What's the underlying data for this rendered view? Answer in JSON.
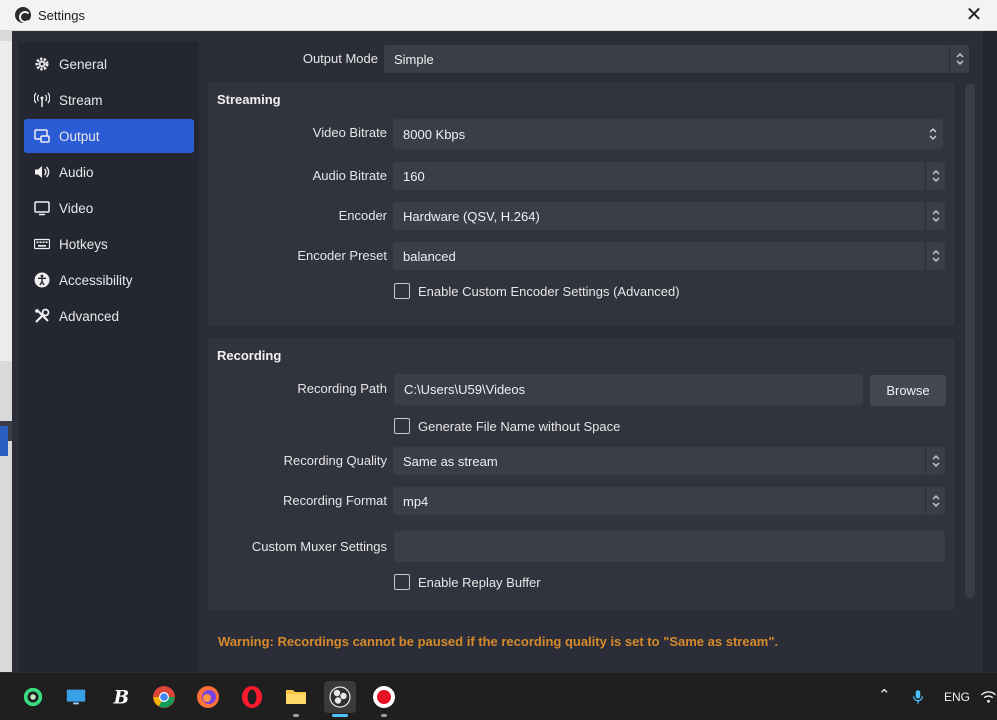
{
  "window": {
    "title": "Settings",
    "close_glyph": "✕"
  },
  "sidebar": {
    "items": [
      {
        "label": "General",
        "icon": "gear-icon"
      },
      {
        "label": "Stream",
        "icon": "antenna-icon"
      },
      {
        "label": "Output",
        "icon": "output-icon",
        "active": true
      },
      {
        "label": "Audio",
        "icon": "speaker-icon"
      },
      {
        "label": "Video",
        "icon": "monitor-icon"
      },
      {
        "label": "Hotkeys",
        "icon": "keyboard-icon"
      },
      {
        "label": "Accessibility",
        "icon": "accessibility-icon"
      },
      {
        "label": "Advanced",
        "icon": "tools-icon"
      }
    ]
  },
  "output_mode": {
    "label": "Output Mode",
    "value": "Simple"
  },
  "streaming": {
    "title": "Streaming",
    "video_bitrate": {
      "label": "Video Bitrate",
      "value": "8000 Kbps"
    },
    "audio_bitrate": {
      "label": "Audio Bitrate",
      "value": "160"
    },
    "encoder": {
      "label": "Encoder",
      "value": "Hardware (QSV, H.264)"
    },
    "encoder_preset": {
      "label": "Encoder Preset",
      "value": "balanced"
    },
    "custom_encoder": {
      "label": "Enable Custom Encoder Settings (Advanced)",
      "checked": false
    }
  },
  "recording": {
    "title": "Recording",
    "path": {
      "label": "Recording Path",
      "value": "C:\\Users\\U59\\Videos"
    },
    "browse_label": "Browse",
    "no_space": {
      "label": "Generate File Name without Space",
      "checked": false
    },
    "quality": {
      "label": "Recording Quality",
      "value": "Same as stream"
    },
    "format": {
      "label": "Recording Format",
      "value": "mp4"
    },
    "muxer": {
      "label": "Custom Muxer Settings",
      "value": ""
    },
    "replay_buffer": {
      "label": "Enable Replay Buffer",
      "checked": false
    }
  },
  "warning": "Warning: Recordings cannot be paused if the recording quality is set to \"Same as stream\".",
  "taskbar": {
    "apps": [
      "android-studio-icon",
      "desktop-icon",
      "b-app-icon",
      "chrome-icon",
      "firefox-icon",
      "opera-icon",
      "file-explorer-icon",
      "obs-icon",
      "record-icon"
    ],
    "tray_language": "ENG"
  },
  "colors": {
    "accent": "#2c5bd6",
    "warning": "#d68a2a",
    "window_bg": "#2b2e38"
  }
}
